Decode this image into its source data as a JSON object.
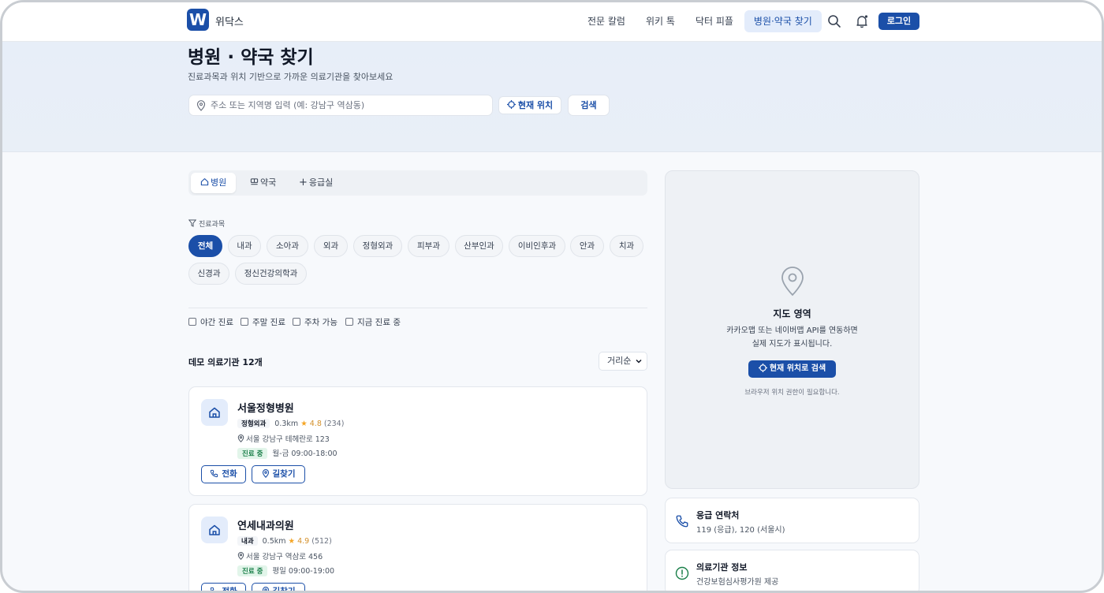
{
  "header": {
    "logo_letter": "W",
    "brand": "위닥스",
    "nav": [
      "전문 칼럼",
      "위키 톡",
      "닥터 피플",
      "병원·약국 찾기"
    ],
    "login": "로그인"
  },
  "hero": {
    "title": "병원 · 약국 찾기",
    "subtitle": "진료과목과 위치 기반으로 가까운 의료기관을 찾아보세요",
    "search_placeholder": "주소 또는 지역명 입력 (예: 강남구 역삼동)",
    "location_button": "현재 위치",
    "search_button": "검색"
  },
  "tabs": [
    "병원",
    "약국",
    "응급실"
  ],
  "specialty": {
    "label": "진료과목",
    "chips": [
      "전체",
      "내과",
      "소아과",
      "외과",
      "정형외과",
      "피부과",
      "산부인과",
      "이비인후과",
      "안과",
      "치과",
      "신경과",
      "정신건강의학과"
    ]
  },
  "filters": [
    "야간 진료",
    "주말 진료",
    "주차 가능",
    "지금 진료 중"
  ],
  "results": {
    "count_label": "데모 의료기관 12개",
    "sort": "거리순"
  },
  "hospitals": [
    {
      "name": "서울정형병원",
      "specialty": "정형외과",
      "distance": "0.3km",
      "rating": "4.8",
      "reviews": "(234)",
      "address": "서울 강남구 테헤란로 123",
      "status": "진료 중",
      "hours": "월-금 09:00-18:00",
      "call": "전화",
      "directions": "길찾기"
    },
    {
      "name": "연세내과의원",
      "specialty": "내과",
      "distance": "0.5km",
      "rating": "4.9",
      "reviews": "(512)",
      "address": "서울 강남구 역삼로 456",
      "status": "진료 중",
      "hours": "평일 09:00-19:00",
      "call": "전화",
      "directions": "길찾기"
    }
  ],
  "map": {
    "title": "지도 영역",
    "desc_line1": "카카오맵 또는 네이버맵 API를 연동하면",
    "desc_line2": "실제 지도가 표시됩니다.",
    "button": "현재 위치로 검색",
    "note": "브라우저 위치 권한이 필요합니다."
  },
  "emergency": {
    "title": "응급 연락처",
    "text": "119 (응급), 120 (서울시)"
  },
  "info": {
    "title": "의료기관 정보",
    "text": "건강보험심사평가원 제공"
  },
  "colors": {
    "brand": "#1b4fa8",
    "open_green": "#1a7f49",
    "star": "#f5a524"
  }
}
